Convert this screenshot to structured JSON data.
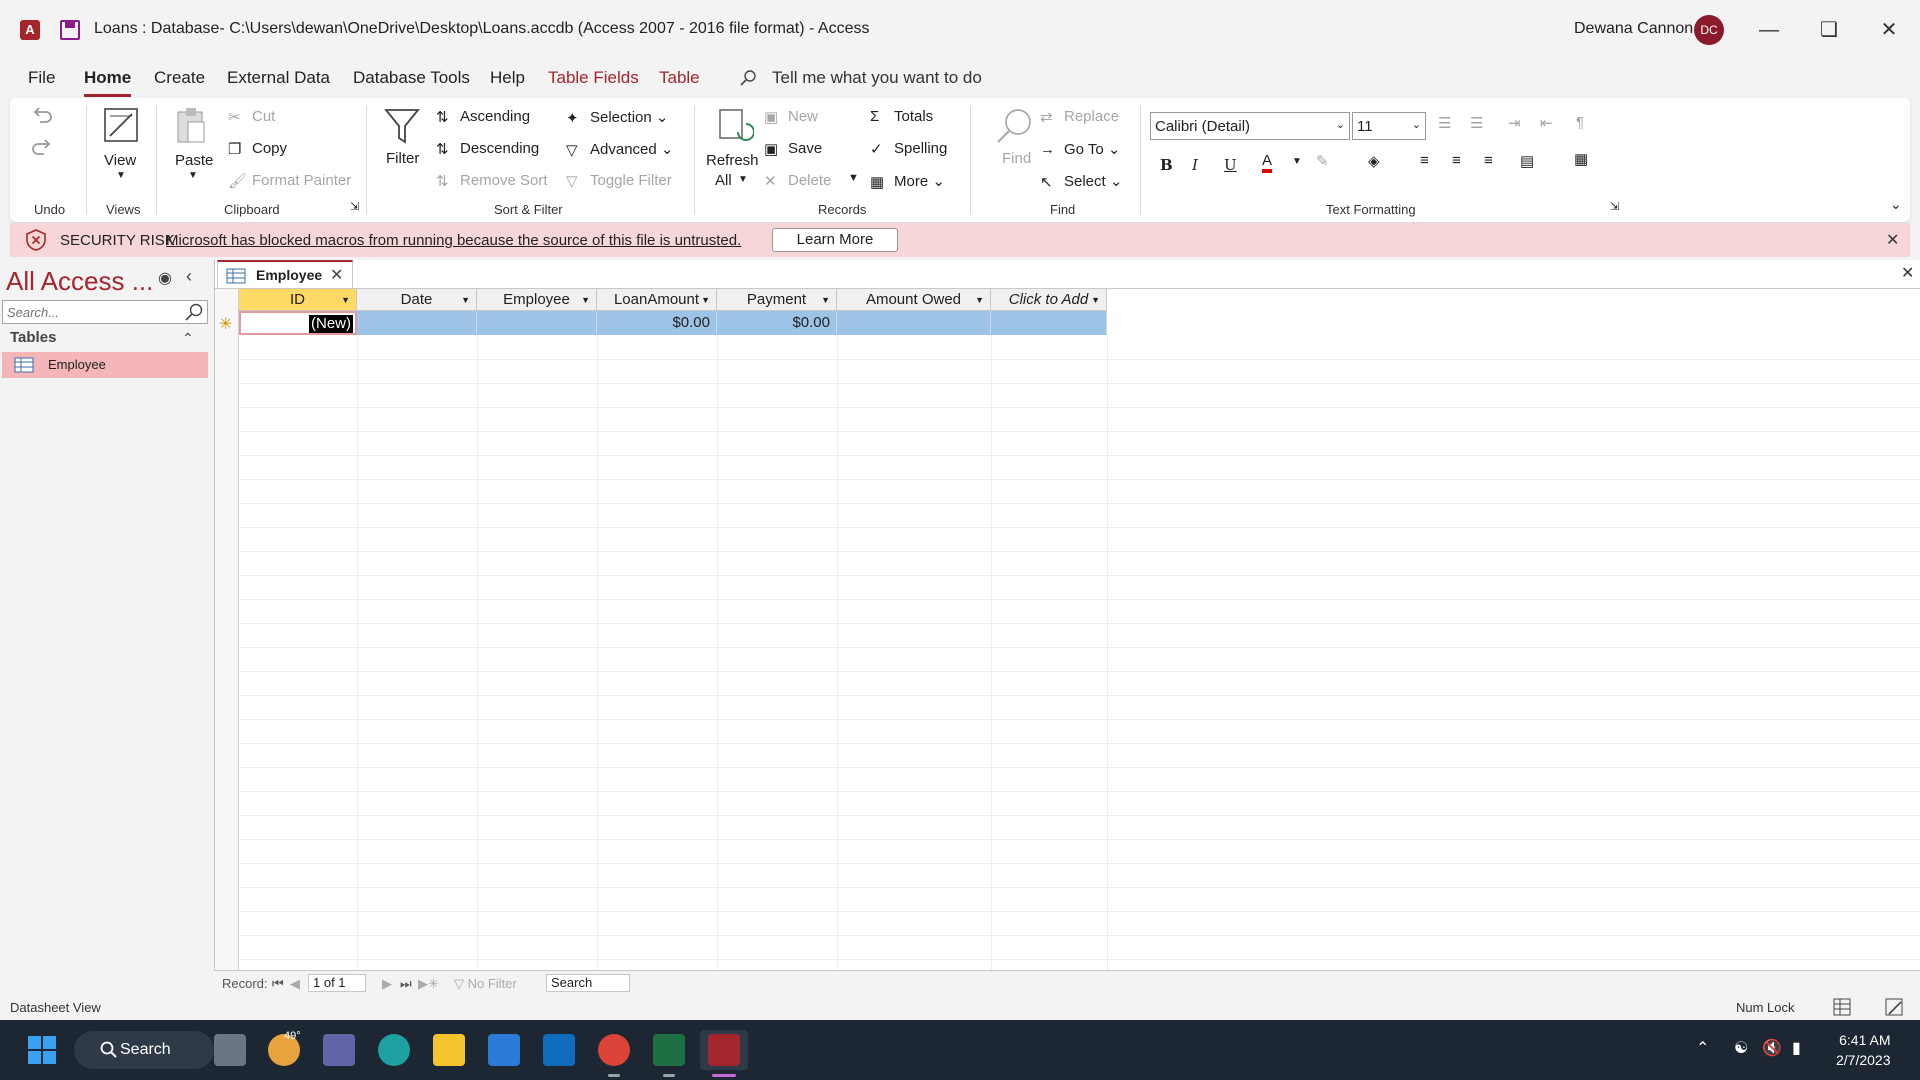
{
  "app": {
    "title": "Loans : Database- C:\\Users\\dewan\\OneDrive\\Desktop\\Loans.accdb (Access 2007 - 2016 file format)  -  Access",
    "logo": "A",
    "user_name": "Dewana Cannon",
    "user_initials": "DC",
    "accent": "#a4262c"
  },
  "tabs": [
    "File",
    "Home",
    "Create",
    "External Data",
    "Database Tools",
    "Help",
    "Table Fields",
    "Table"
  ],
  "tell_me": "Tell me what you want to do",
  "ribbon": {
    "undo_group": "Undo",
    "view": "View",
    "views_group": "Views",
    "paste": "Paste",
    "cut": "Cut",
    "copy": "Copy",
    "format_painter": "Format Painter",
    "clipboard_group": "Clipboard",
    "filter": "Filter",
    "ascending": "Ascending",
    "descending": "Descending",
    "remove_sort": "Remove Sort",
    "selection": "Selection",
    "advanced": "Advanced",
    "toggle_filter": "Toggle Filter",
    "sort_filter_group": "Sort & Filter",
    "refresh": "Refresh",
    "refresh_all": "All",
    "new": "New",
    "save": "Save",
    "delete": "Delete",
    "totals": "Totals",
    "spelling": "Spelling",
    "more": "More",
    "records_group": "Records",
    "find": "Find",
    "replace": "Replace",
    "go_to": "Go To",
    "select": "Select",
    "find_group": "Find",
    "font_name": "Calibri (Detail)",
    "font_size": "11",
    "bold": "B",
    "italic": "I",
    "underline": "U",
    "font_color_letter": "A",
    "text_formatting_group": "Text Formatting"
  },
  "security": {
    "label": "SECURITY RISK",
    "message": "Microsoft has blocked macros from running because the source of this file is untrusted.",
    "button": "Learn More"
  },
  "nav": {
    "title": "All Access ...",
    "search_placeholder": "Search...",
    "category": "Tables",
    "items": [
      {
        "label": "Employee"
      }
    ]
  },
  "document": {
    "tab_label": "Employee",
    "columns": [
      {
        "label": "ID"
      },
      {
        "label": "Date"
      },
      {
        "label": "Employee"
      },
      {
        "label": "LoanAmount"
      },
      {
        "label": "Payment"
      },
      {
        "label": "Amount Owed"
      },
      {
        "label": "Click to Add"
      }
    ],
    "new_row": {
      "id": "(New)",
      "loan_amount": "$0.00",
      "payment": "$0.00"
    }
  },
  "record_nav": {
    "label": "Record:",
    "position": "1 of 1",
    "filter": "No Filter",
    "search": "Search"
  },
  "status": {
    "left": "Datasheet View",
    "num_lock": "Num Lock"
  },
  "taskbar": {
    "search": "Search",
    "weather": "49°",
    "time": "6:41 AM",
    "date": "2/7/2023"
  }
}
